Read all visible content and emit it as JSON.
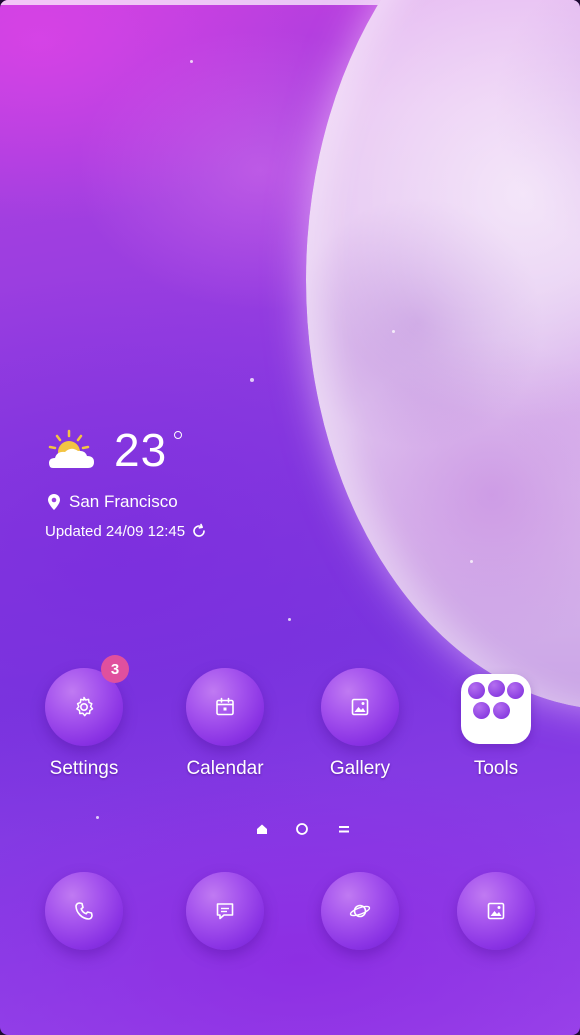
{
  "weather": {
    "temperature": "23",
    "location": "San Francisco",
    "updated": "Updated 24/09 12:45",
    "icon": "partly-sunny-icon"
  },
  "apps_row1": [
    {
      "label": "Settings",
      "icon": "gear-icon",
      "badge": "3"
    },
    {
      "label": "Calendar",
      "icon": "calendar-icon"
    },
    {
      "label": "Gallery",
      "icon": "picture-icon"
    },
    {
      "label": "Tools",
      "icon": "folder-icon"
    }
  ],
  "page_indicators": [
    "home-indicator",
    "page-dot-indicator",
    "app-drawer-indicator"
  ],
  "dock": [
    {
      "icon": "phone-icon"
    },
    {
      "icon": "message-icon"
    },
    {
      "icon": "planet-icon"
    },
    {
      "icon": "gallery-icon"
    }
  ],
  "colors": {
    "background_top": "#c23fde",
    "background_bottom": "#9a44ea",
    "moon": "#e9c7f3",
    "icon_circle": "#a655ee",
    "badge": "#e0509e"
  }
}
